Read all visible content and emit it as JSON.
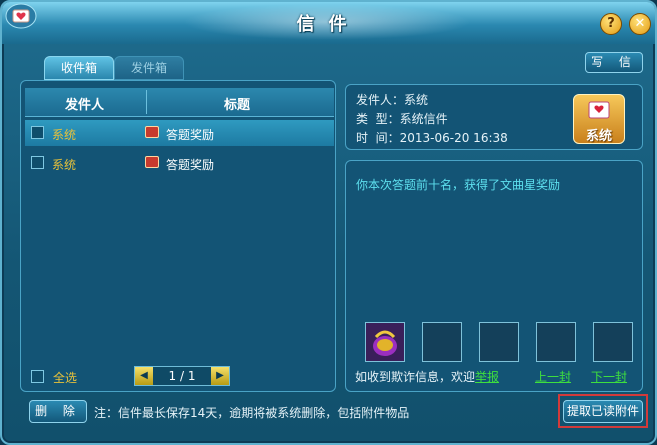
{
  "window": {
    "title": "信件",
    "help_label": "?",
    "close_label": "✕"
  },
  "tabs": [
    {
      "label": "收件箱"
    },
    {
      "label": "发件箱"
    }
  ],
  "write_label": "写 信",
  "list": {
    "headers": {
      "sender": "发件人",
      "subject": "标题"
    },
    "rows": [
      {
        "sender": "系统",
        "subject": "答题奖励",
        "selected": true
      },
      {
        "sender": "系统",
        "subject": "答题奖励",
        "selected": false
      }
    ],
    "select_all_label": "全选",
    "pager": {
      "text": "1 / 1"
    }
  },
  "detail": {
    "sender_line": "发件人：系统",
    "type_line": "类  型：系统信件",
    "time_line": "时  间：2013-06-20 16:38",
    "badge_label": "系统",
    "body": "你本次答题前十名，获得了文曲星奖励",
    "report_prefix": "如收到欺诈信息，欢迎",
    "report_link": "举报",
    "prev_link": "上一封",
    "next_link": "下一封"
  },
  "footer": {
    "delete_label": "删 除",
    "note": "注：信件最长保存14天，逾期将被系统删除，包括附件物品",
    "extract_label": "提取已读附件"
  },
  "colors": {
    "highlight_border": "#d23a3a",
    "link": "#3ee03e",
    "sender": "#e8c23a"
  }
}
